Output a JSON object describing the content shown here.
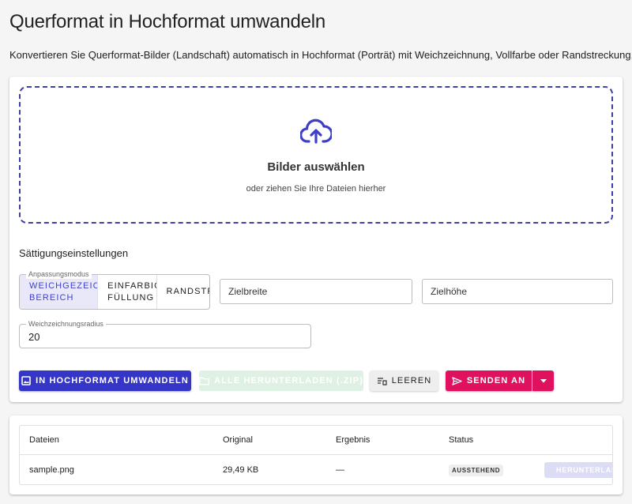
{
  "header": {
    "title": "Querformat in Hochformat umwandeln",
    "subtitle": "Konvertieren Sie Querformat-Bilder (Landschaft) automatisch in Hochformat (Porträt) mit Weichzeichnung, Vollfarbe oder Randstreckung."
  },
  "dropzone": {
    "icon": "cloud-upload-icon",
    "title": "Bilder auswählen",
    "hint": "oder ziehen Sie Ihre Dateien hierher"
  },
  "settings": {
    "section_label": "Sättigungseinstellungen",
    "mode_legend": "Anpassungsmodus",
    "modes": [
      {
        "line1": "Weichgezeichneter",
        "line2": "Bereich",
        "active": true
      },
      {
        "line1": "Einfarbige",
        "line2": "Füllung",
        "active": false
      },
      {
        "line1": "Randstreckung",
        "line2": "",
        "active": false
      }
    ],
    "width_placeholder": "Zielbreite",
    "height_placeholder": "Zielhöhe",
    "radius_legend": "Weichzeichnungsradius",
    "radius_value": "20"
  },
  "actions": {
    "convert": "In Hochformat umwandeln",
    "download_all": "Alle herunterladen (.zip)",
    "clear": "Leeren",
    "send": "Senden an"
  },
  "table": {
    "headers": [
      "Dateien",
      "Original",
      "Ergebnis",
      "Status"
    ],
    "rows": [
      {
        "file": "sample.png",
        "original": "29,49 KB",
        "result": "—",
        "status": "AUSSTEHEND",
        "download": "Herunterladen"
      }
    ]
  },
  "colors": {
    "primary": "#3535c8",
    "accent": "#e0115f",
    "dropzone_border": "#3f3fa8"
  }
}
